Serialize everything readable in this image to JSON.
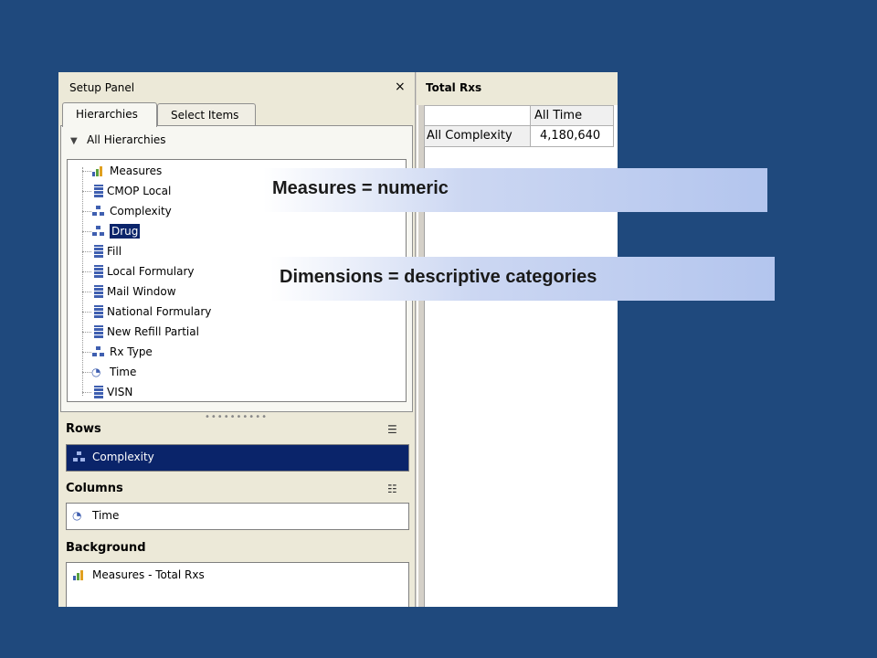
{
  "setup_panel": {
    "title": "Setup Panel",
    "close": "×",
    "tabs": [
      {
        "label": "Hierarchies",
        "active": true
      },
      {
        "label": "Select Items",
        "active": false
      }
    ],
    "filter_label": "All Hierarchies",
    "tree_items": [
      {
        "label": "Measures",
        "icon": "measures-icon"
      },
      {
        "label": "CMOP Local",
        "icon": "dimension-icon"
      },
      {
        "label": "Complexity",
        "icon": "hierarchy-icon"
      },
      {
        "label": "Drug",
        "icon": "hierarchy-icon",
        "selected": true
      },
      {
        "label": "Fill",
        "icon": "dimension-icon"
      },
      {
        "label": "Local Formulary",
        "icon": "dimension-icon"
      },
      {
        "label": "Mail Window",
        "icon": "dimension-icon"
      },
      {
        "label": "National Formulary",
        "icon": "dimension-icon"
      },
      {
        "label": "New Refill Partial",
        "icon": "dimension-icon"
      },
      {
        "label": "Rx Type",
        "icon": "hierarchy-icon"
      },
      {
        "label": "Time",
        "icon": "time-icon"
      },
      {
        "label": "VISN",
        "icon": "dimension-icon"
      }
    ],
    "grip": "••••••••••",
    "rows": {
      "label": "Rows",
      "value": "Complexity"
    },
    "columns": {
      "label": "Columns",
      "value": "Time"
    },
    "background": {
      "label": "Background",
      "value": "Measures - Total Rxs"
    }
  },
  "pivot": {
    "title": "Total Rxs",
    "column_header": "All Time",
    "row_header": "All Complexity",
    "value": "4,180,640"
  },
  "callouts": {
    "measures": "Measures = numeric",
    "dimensions": "Dimensions = descriptive categories"
  },
  "colors": {
    "background": "#1f497d",
    "selection": "#0a246a"
  }
}
